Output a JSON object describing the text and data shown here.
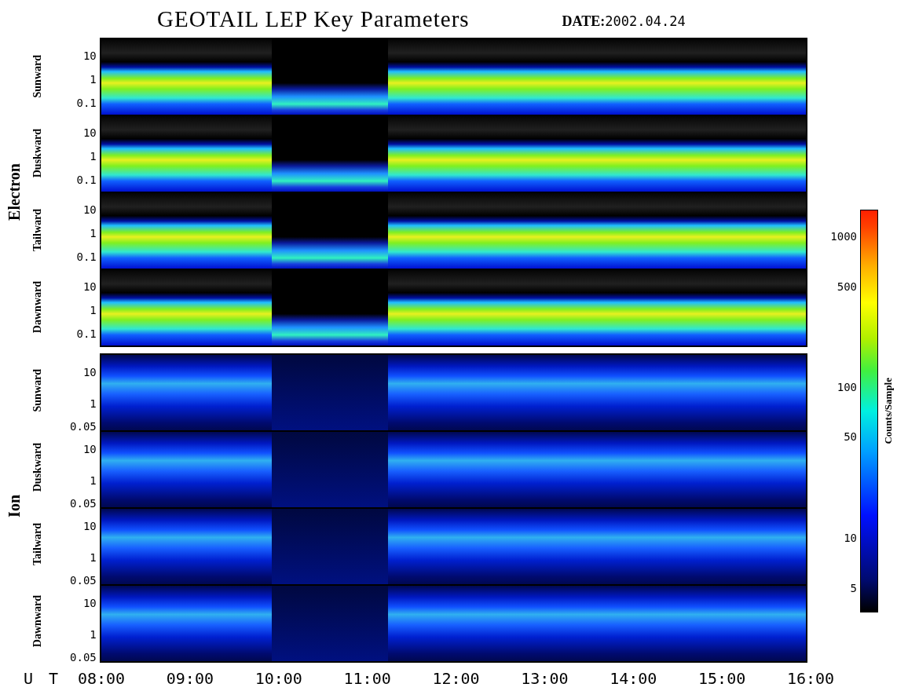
{
  "title": "GEOTAIL LEP Key Parameters",
  "date": {
    "label": "DATE:",
    "value": "2002.04.24"
  },
  "groups": [
    {
      "name": "Electron",
      "kind": "electron",
      "panels": [
        {
          "label": "Sunward",
          "yticks": [
            "10",
            "1",
            "0.1"
          ]
        },
        {
          "label": "Duskward",
          "yticks": [
            "10",
            "1",
            "0.1"
          ]
        },
        {
          "label": "Tailward",
          "yticks": [
            "10",
            "1",
            "0.1"
          ]
        },
        {
          "label": "Dawnward",
          "yticks": [
            "10",
            "1",
            "0.1"
          ]
        }
      ]
    },
    {
      "name": "Ion",
      "kind": "ion",
      "panels": [
        {
          "label": "Sunward",
          "yticks": [
            "10",
            "1",
            "0.05"
          ]
        },
        {
          "label": "Duskward",
          "yticks": [
            "10",
            "1",
            "0.05"
          ]
        },
        {
          "label": "Tailward",
          "yticks": [
            "10",
            "1",
            "0.05"
          ]
        },
        {
          "label": "Dawnward",
          "yticks": [
            "10",
            "1",
            "0.05"
          ]
        }
      ]
    }
  ],
  "time_axis": {
    "label": "U T",
    "ticks": [
      "08:00",
      "09:00",
      "10:00",
      "11:00",
      "12:00",
      "13:00",
      "14:00",
      "15:00",
      "16:00"
    ]
  },
  "colorbar": {
    "label": "Counts/Sample",
    "ticks": [
      "1000",
      "500",
      "100",
      "50",
      "10",
      "5"
    ]
  }
}
